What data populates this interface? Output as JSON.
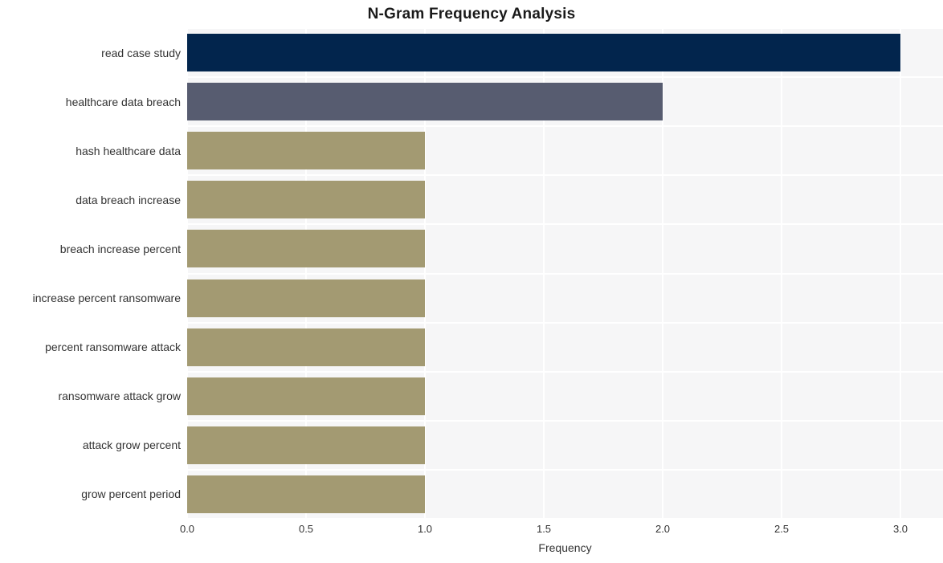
{
  "chart_data": {
    "type": "bar",
    "orientation": "horizontal",
    "title": "N-Gram Frequency Analysis",
    "xlabel": "Frequency",
    "ylabel": "",
    "xlim": [
      0.0,
      3.0
    ],
    "xticks": [
      "0.0",
      "0.5",
      "1.0",
      "1.5",
      "2.0",
      "2.5",
      "3.0"
    ],
    "xtick_values": [
      0.0,
      0.5,
      1.0,
      1.5,
      2.0,
      2.5,
      3.0
    ],
    "grid": true,
    "legend": "none",
    "categories": [
      "read case study",
      "healthcare data breach",
      "hash healthcare data",
      "data breach increase",
      "breach increase percent",
      "increase percent ransomware",
      "percent ransomware attack",
      "ransomware attack grow",
      "attack grow percent",
      "grow percent period"
    ],
    "values": [
      3,
      2,
      1,
      1,
      1,
      1,
      1,
      1,
      1,
      1
    ],
    "bar_colors": [
      "#02254d",
      "#575c70",
      "#a39a72",
      "#a39a72",
      "#a39a72",
      "#a39a72",
      "#a39a72",
      "#a39a72",
      "#a39a72",
      "#a39a72"
    ]
  },
  "style": {
    "plot_background": "#f6f6f7",
    "gridline_color": "#ffffff",
    "figure_background": "#ffffff",
    "text_color": "#333333",
    "title_color": "#1a1a1a"
  }
}
